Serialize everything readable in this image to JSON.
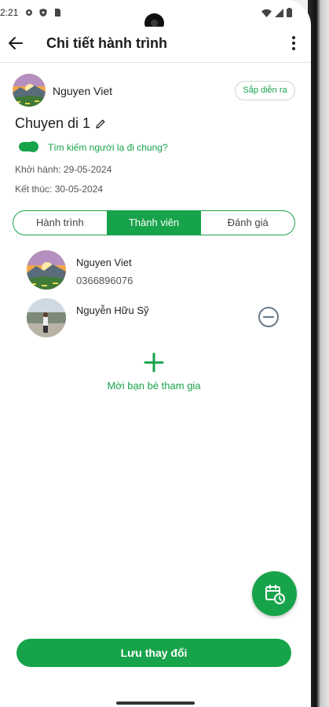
{
  "status_bar": {
    "time": "2:21"
  },
  "app_bar": {
    "title": "Chi tiết hành trình"
  },
  "trip": {
    "owner_name": "Nguyen Viet",
    "status": "Sắp diễn ra",
    "name": "Chuyen di 1",
    "toggle_label": "Tìm kiếm người lạ đi chung?",
    "start": "Khởi hành: 29-05-2024",
    "end": "Kết thúc: 30-05-2024"
  },
  "tabs": [
    {
      "label": "Hành trình"
    },
    {
      "label": "Thành viên",
      "active": true
    },
    {
      "label": "Đánh giá"
    }
  ],
  "members": [
    {
      "name": "Nguyen Viet",
      "phone": "0366896076"
    },
    {
      "name": "Nguyễn Hữu Sỹ",
      "phone": ""
    }
  ],
  "invite": {
    "label": "Mời bạn bè tham gia"
  },
  "save_button": {
    "label": "Lưu thay đổi"
  },
  "colors": {
    "accent": "#17a34a"
  }
}
